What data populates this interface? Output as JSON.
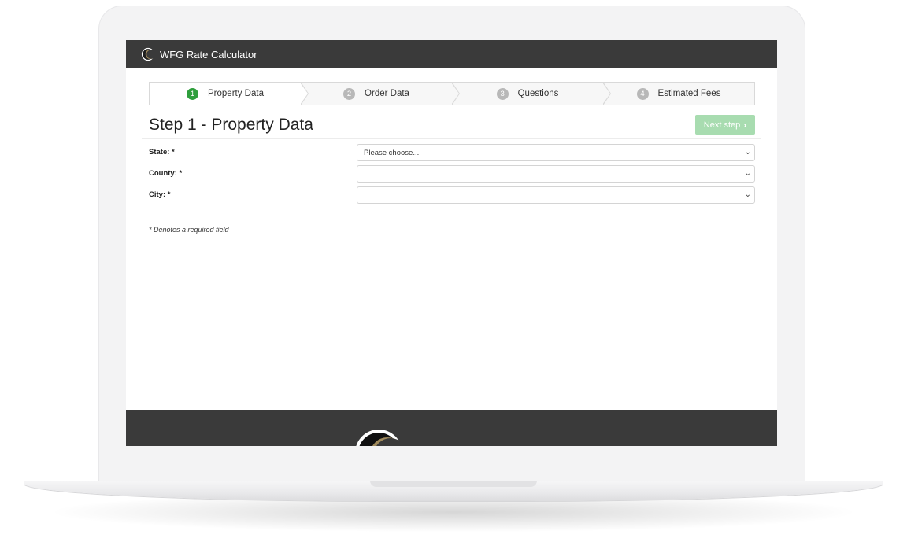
{
  "app": {
    "brand": "WFG Rate Calculator"
  },
  "stepper": {
    "steps": [
      {
        "number": "1",
        "label": "Property Data",
        "active": true
      },
      {
        "number": "2",
        "label": "Order Data",
        "active": false
      },
      {
        "number": "3",
        "label": "Questions",
        "active": false
      },
      {
        "number": "4",
        "label": "Estimated Fees",
        "active": false
      }
    ]
  },
  "page": {
    "title": "Step 1 - Property Data",
    "next_label": "Next step"
  },
  "form": {
    "fields": [
      {
        "label": "State: *",
        "value": "Please choose..."
      },
      {
        "label": "County: *",
        "value": ""
      },
      {
        "label": "City: *",
        "value": ""
      }
    ],
    "note": "* Denotes a required field"
  },
  "colors": {
    "navbar": "#3a3a3a",
    "active_step": "#2e9e3c",
    "next_button": "#a8dcb0"
  },
  "icons": {
    "logo": "crescent-logo-icon",
    "select_caret": "chevron-down-icon",
    "next_chevron": "chevron-right-icon"
  }
}
